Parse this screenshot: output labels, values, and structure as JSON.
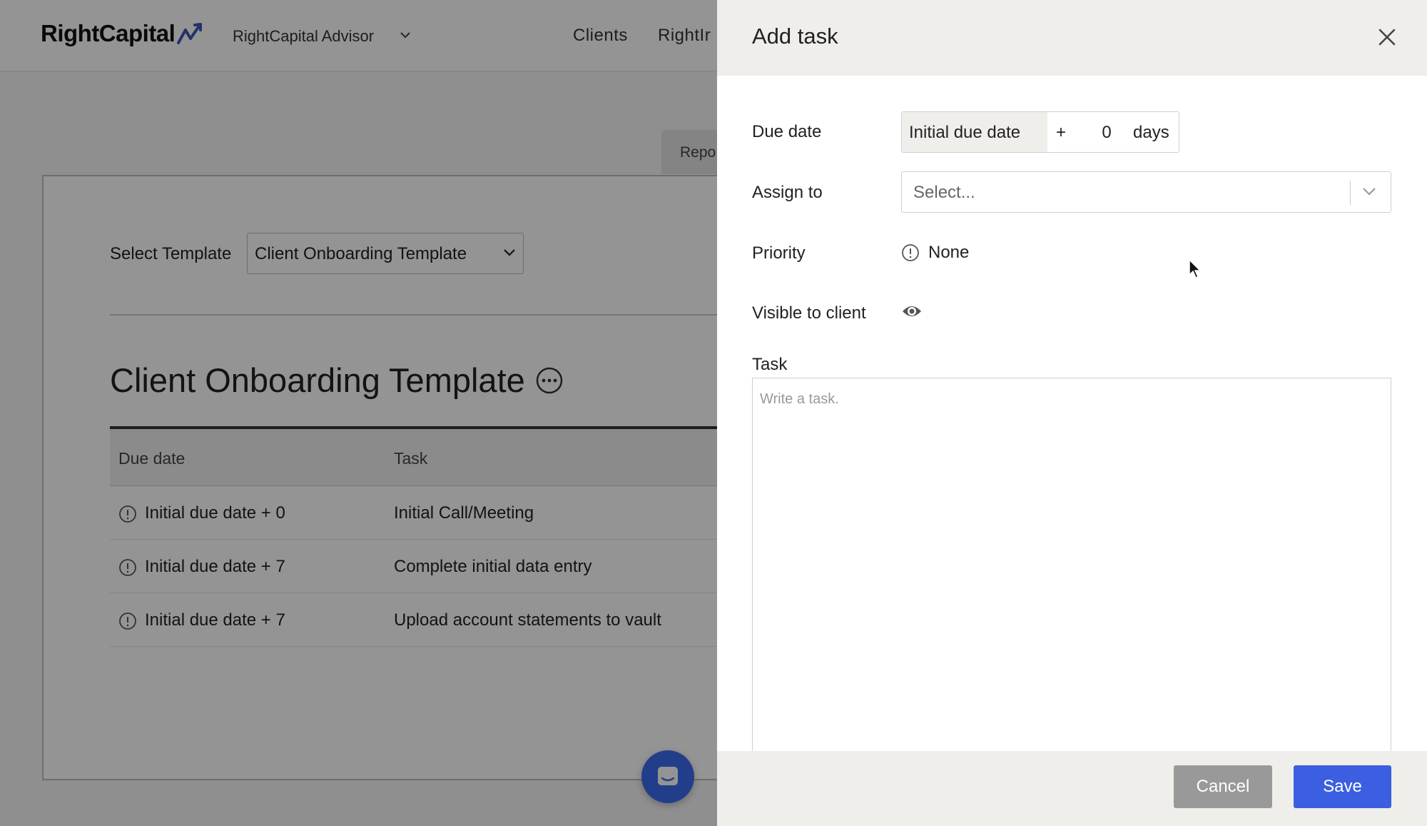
{
  "app": {
    "logo_text": "RightCapital",
    "advisor_name": "RightCapital Advisor",
    "nav": {
      "clients": "Clients",
      "rightindex_partial": "RightIr"
    },
    "reports_tab_partial": "Repo",
    "select_template_label": "Select Template",
    "selected_template": "Client Onboarding Template",
    "template_title": "Client Onboarding Template",
    "table": {
      "headers": {
        "due_date": "Due date",
        "task": "Task"
      },
      "rows": [
        {
          "due": "Initial due date + 0",
          "task": "Initial Call/Meeting"
        },
        {
          "due": "Initial due date + 7",
          "task": "Complete initial data entry"
        },
        {
          "due": "Initial due date + 7",
          "task": "Upload account statements to vault"
        }
      ]
    }
  },
  "drawer": {
    "title": "Add task",
    "due_date": {
      "label": "Due date",
      "base": "Initial due date",
      "operator": "+",
      "offset_value": "0",
      "unit": "days"
    },
    "assign_to": {
      "label": "Assign to",
      "placeholder": "Select..."
    },
    "priority": {
      "label": "Priority",
      "value": "None"
    },
    "visible_to_client": {
      "label": "Visible to client"
    },
    "task": {
      "label": "Task",
      "placeholder": "Write a task.",
      "value": ""
    },
    "buttons": {
      "cancel": "Cancel",
      "save": "Save"
    }
  },
  "colors": {
    "brand_accent": "#3b5fe0",
    "logo_arrow": "#3d56b8",
    "chat_bubble": "#3c6cf0",
    "cancel_button": "#999999",
    "overlay": "rgba(0,0,0,0.42)"
  },
  "icons": {
    "close": "close-icon",
    "priority": "exclamation-circle-icon",
    "visibility": "eye-icon",
    "dropdown": "chevron-down-icon",
    "more": "ellipsis-circle-icon",
    "chat": "chat-icon"
  }
}
